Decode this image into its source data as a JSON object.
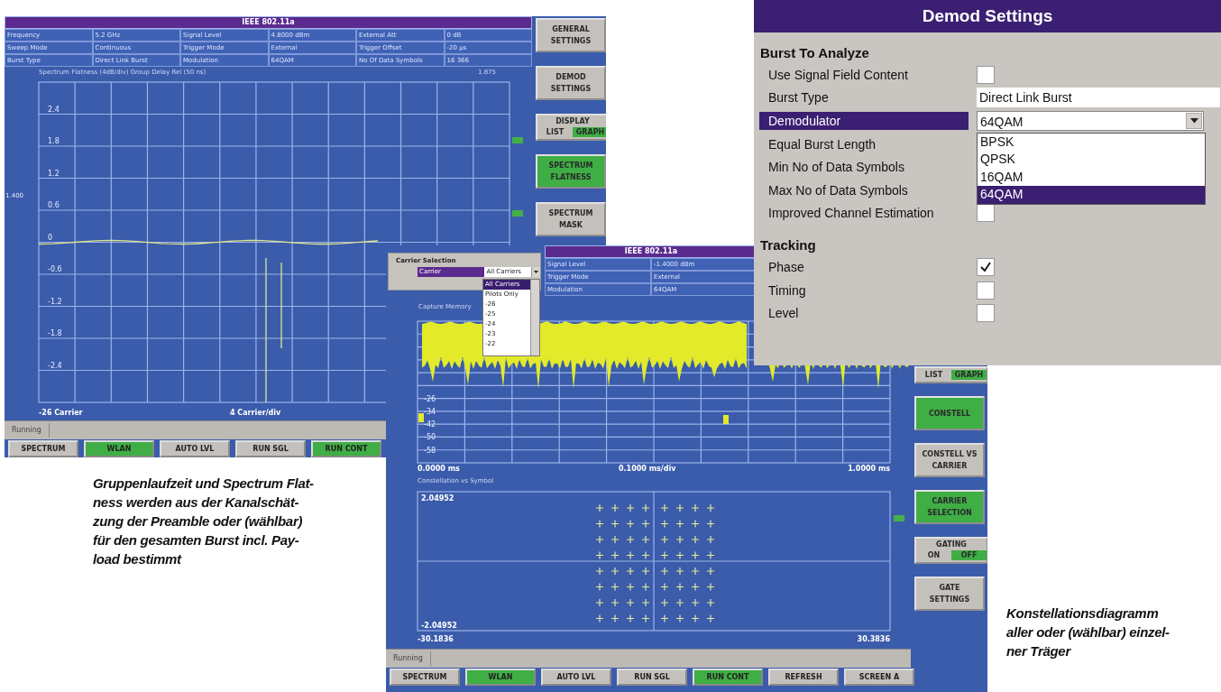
{
  "flatness_screen": {
    "title": "IEEE 802.11a",
    "params": [
      [
        "Frequency",
        "5.2 GHz",
        "Signal Level",
        "4.8000 dBm",
        "External Att",
        "0 dB"
      ],
      [
        "Sweep Mode",
        "Continuous",
        "Trigger Mode",
        "External",
        "Trigger Offset",
        "-20 µs"
      ],
      [
        "Burst Type",
        "Direct Link Burst",
        "Modulation",
        "64QAM",
        "No Of Data Symbols",
        "16 366"
      ]
    ],
    "chart_title": "Spectrum Flatness (4dB/div) Group Delay Rel (50 ns)",
    "corner_value": "1.875",
    "side_value": "1.400",
    "y_ticks": [
      "2.4",
      "1.8",
      "1.2",
      "0.6",
      "0",
      "-0.6",
      "-1.2",
      "-1.8",
      "-2.4"
    ],
    "x_labels": [
      "-26 Carrier",
      "4 Carrier/div"
    ],
    "status": "Running",
    "side_buttons": [
      {
        "kind": "button",
        "label": "GENERAL SETTINGS",
        "active": false
      },
      {
        "kind": "button",
        "label": "DEMOD SETTINGS",
        "active": false
      },
      {
        "kind": "toggle",
        "label": "DISPLAY",
        "options": [
          {
            "label": "LIST",
            "selected": false
          },
          {
            "label": "GRAPH",
            "selected": true
          }
        ]
      },
      {
        "kind": "button",
        "label": "SPECTRUM FLATNESS",
        "active": true
      },
      {
        "kind": "button",
        "label": "SPECTRUM MASK",
        "active": false
      }
    ],
    "bottom_buttons": [
      {
        "label": "SPECTRUM",
        "active": false
      },
      {
        "label": "WLAN",
        "active": true
      },
      {
        "label": "AUTO LVL",
        "active": false
      },
      {
        "label": "RUN SGL",
        "active": false
      },
      {
        "label": "RUN CONT",
        "active": true
      }
    ]
  },
  "constellation_screen": {
    "title": "IEEE 802.11a",
    "params": [
      [
        "Signal Level",
        "-1.4000 dBm"
      ],
      [
        "Trigger Mode",
        "External"
      ],
      [
        "Modulation",
        "64QAM"
      ]
    ],
    "info": "Capture Memory",
    "y_ticks": [
      "-26",
      "-34",
      "-42",
      "-50",
      "-58"
    ],
    "x_labels": [
      "0.0000 ms",
      "0.1000 ms/div",
      "1.0000 ms"
    ],
    "constellation_title": "Constellation vs Symbol",
    "constellation_labels": [
      "2.04952",
      "-2.04952",
      "-30.1836",
      "30.3836"
    ],
    "status": "Running",
    "side_buttons": [
      {
        "kind": "toggle",
        "options": [
          {
            "label": "LIST",
            "selected": false
          },
          {
            "label": "GRAPH",
            "selected": true
          }
        ]
      },
      {
        "kind": "button",
        "label": "CONSTELL",
        "active": true
      },
      {
        "kind": "button",
        "label": "CONSTELL VS CARRIER",
        "active": false
      },
      {
        "kind": "button",
        "label": "CARRIER SELECTION",
        "active": true
      },
      {
        "kind": "toggle",
        "label": "GATING",
        "options": [
          {
            "label": "ON",
            "selected": false
          },
          {
            "label": "OFF",
            "selected": true
          }
        ]
      },
      {
        "kind": "button",
        "label": "GATE SETTINGS",
        "active": false
      }
    ],
    "bottom_buttons": [
      {
        "label": "SPECTRUM",
        "active": false
      },
      {
        "label": "WLAN",
        "active": true
      },
      {
        "label": "AUTO LVL",
        "active": false
      },
      {
        "label": "RUN SGL",
        "active": false
      },
      {
        "label": "RUN CONT",
        "active": true
      },
      {
        "label": "REFRESH",
        "active": false
      },
      {
        "label": "SCREEN A",
        "active": false
      }
    ]
  },
  "carrier_popup": {
    "title": "Carrier Selection",
    "label": "Carrier",
    "value": "All Carriers",
    "options": [
      {
        "label": "All Carriers",
        "selected": true
      },
      {
        "label": "Pilots Only",
        "selected": false
      },
      {
        "label": "-26",
        "selected": false
      },
      {
        "label": "-25",
        "selected": false
      },
      {
        "label": "-24",
        "selected": false
      },
      {
        "label": "-23",
        "selected": false
      },
      {
        "label": "-22",
        "selected": false
      }
    ]
  },
  "demod_settings": {
    "title": "Demod Settings",
    "sections": [
      {
        "heading": "Burst To Analyze",
        "rows": [
          {
            "kind": "checkbox",
            "label": "Use Signal Field Content",
            "checked": false,
            "selected": false
          },
          {
            "kind": "text",
            "label": "Burst Type",
            "value": "Direct Link Burst",
            "selected": false
          },
          {
            "kind": "select",
            "label": "Demodulator",
            "value": "64QAM",
            "selected": true,
            "options": [
              {
                "label": "BPSK",
                "selected": false
              },
              {
                "label": "QPSK",
                "selected": false
              },
              {
                "label": "16QAM",
                "selected": false
              },
              {
                "label": "64QAM",
                "selected": true
              }
            ]
          },
          {
            "kind": "plain",
            "label": "Equal Burst Length",
            "selected": false
          },
          {
            "kind": "plain",
            "label": "Min No of Data Symbols",
            "selected": false
          },
          {
            "kind": "plain",
            "label": "Max No of Data Symbols",
            "selected": false
          },
          {
            "kind": "checkbox",
            "label": "Improved Channel Estimation",
            "checked": false,
            "selected": false
          }
        ]
      },
      {
        "heading": "Tracking",
        "rows": [
          {
            "kind": "checkbox",
            "label": "Phase",
            "checked": true,
            "selected": false
          },
          {
            "kind": "checkbox",
            "label": "Timing",
            "checked": false,
            "selected": false
          },
          {
            "kind": "checkbox",
            "label": "Level",
            "checked": false,
            "selected": false
          }
        ]
      }
    ]
  },
  "captions": [
    "Gruppenlaufzeit und Spectrum Flat-\nness werden aus der Kanalschät-\nzung der Preamble oder (wählbar)\nfür den gesamten Burst incl. Pay-\nload bestimmt",
    "Konstellationsdiagramm\naller oder (wählbar) einzel-\nner Träger"
  ]
}
